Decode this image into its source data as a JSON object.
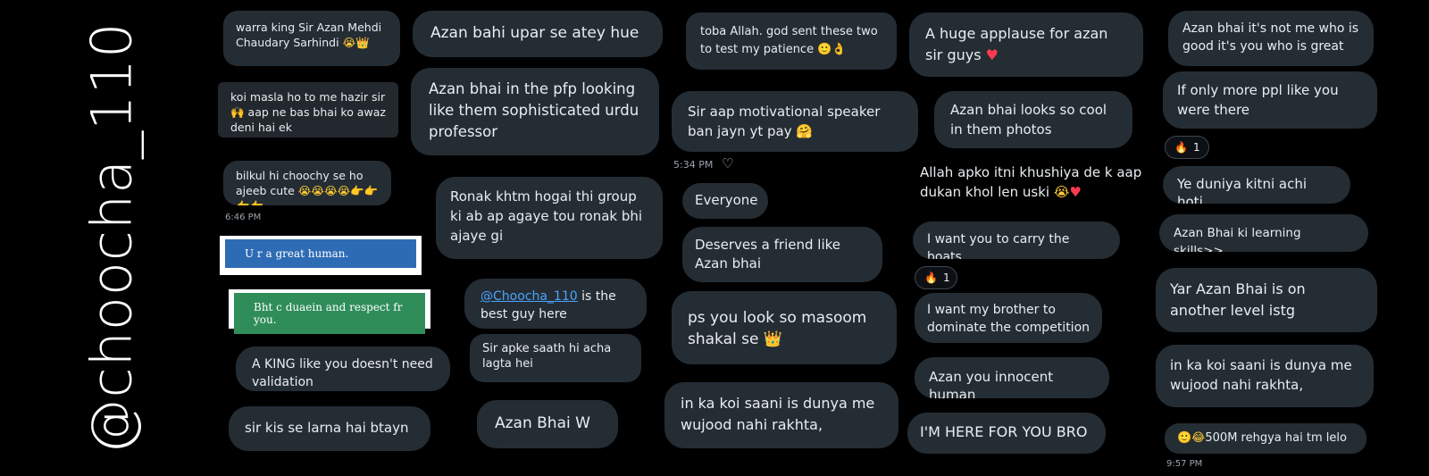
{
  "handle": "@choocha_110",
  "colors": {
    "bubble": "#252d34",
    "mention": "#4aa4ff",
    "card_blue": "#2e6bb5",
    "card_green": "#2f8d5a"
  },
  "col1": {
    "m1": "warra king Sir Azan Mehdi Chaudary Sarhindi",
    "m2": "koi masla ho to me hazir sir 🙌 aap ne bas bhai ko awaz deni hai ek",
    "m3": "bilkul hi choochy se ho ajeeb cute",
    "m3_time": "6:46 PM",
    "card1": "U r a great human.",
    "card2": "Bht c duaein and respect fr you.",
    "m4": "A KING like you doesn't need validation",
    "m5": "sir kis se larna hai btayn"
  },
  "col2": {
    "m1": "Azan bahi upar se atey hue",
    "m2": "Azan bhai in the pfp looking like them sophisticated urdu professor",
    "m3": "Ronak khtm hogai thi group ki ab ap agaye tou ronak bhi ajaye gi",
    "m4_mention": "@Choocha_110",
    "m4_rest": " is the best guy here",
    "m5": "Sir apke saath hi acha lagta hei",
    "m6": "Azan Bhai W"
  },
  "col3": {
    "m1": "toba Allah. god sent these two to test my patience",
    "m2": "Sir aap motivational speaker ban jayn yt pay",
    "m2_time": "5:34 PM",
    "m3": "Everyone",
    "m4": "Deserves a friend like Azan bhai",
    "m5": "ps you look so masoom shakal se",
    "m6": "in ka koi saani is dunya me wujood nahi rakhta,"
  },
  "col4": {
    "m1": "A huge applause for azan sir guys",
    "m2": "Azan bhai looks so cool in them photos",
    "m3": "Allah apko itni khushiya de k aap dukan khol len uski",
    "m4": "I want you to carry the boats",
    "m4_react_count": "1",
    "m5": "I want my brother to dominate the competition",
    "m6": "Azan you innocent human",
    "m7": "I'M HERE FOR YOU BRO"
  },
  "col5": {
    "m1": "Azan bhai it's not me who is good it's you who is great",
    "m2": "If only more ppl like you were there",
    "m2_react_count": "1",
    "m3": "Ye duniya kitni achi hoti",
    "m4": "Azan Bhai ki learning skills>>",
    "m5": "Yar Azan Bhai is on another level istg",
    "m6": "in ka koi saani is dunya me wujood nahi rakhta,",
    "m7": "500M rehgya hai tm lelo",
    "m7_time": "9:57 PM"
  }
}
